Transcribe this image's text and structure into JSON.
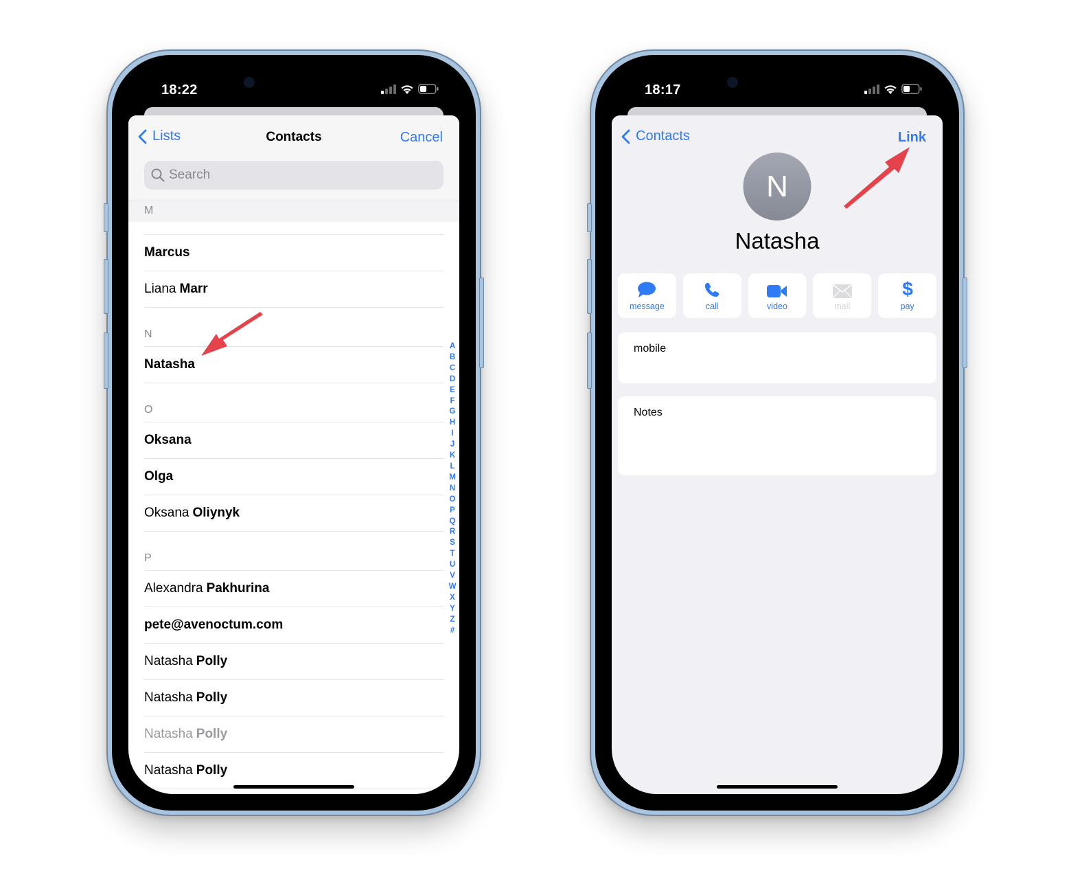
{
  "left_phone": {
    "status": {
      "time": "18:22"
    },
    "navbar": {
      "back_label": "Lists",
      "title": "Contacts",
      "right_label": "Cancel"
    },
    "search": {
      "placeholder": "Search"
    },
    "sections": [
      {
        "letter": "M",
        "rows": [
          {
            "first": "",
            "last": "Marcus",
            "dim": false
          },
          {
            "first": "Liana",
            "last": "Marr",
            "dim": false
          }
        ]
      },
      {
        "letter": "N",
        "rows": [
          {
            "first": "",
            "last": "Natasha",
            "dim": false
          }
        ]
      },
      {
        "letter": "O",
        "rows": [
          {
            "first": "",
            "last": "Oksana",
            "dim": false
          },
          {
            "first": "",
            "last": "Olga",
            "dim": false
          },
          {
            "first": "Oksana",
            "last": "Oliynyk",
            "dim": false
          }
        ]
      },
      {
        "letter": "P",
        "rows": [
          {
            "first": "Alexandra",
            "last": "Pakhurina",
            "dim": false
          },
          {
            "first": "",
            "last": "pete@avenoctum.com",
            "dim": false
          },
          {
            "first": "Natasha",
            "last": "Polly",
            "dim": false
          },
          {
            "first": "Natasha",
            "last": "Polly",
            "dim": false
          },
          {
            "first": "Natasha",
            "last": "Polly",
            "dim": true
          },
          {
            "first": "Natasha",
            "last": "Polly",
            "dim": false
          }
        ]
      }
    ],
    "index_letters": [
      "A",
      "B",
      "C",
      "D",
      "E",
      "F",
      "G",
      "H",
      "I",
      "J",
      "K",
      "L",
      "M",
      "N",
      "O",
      "P",
      "Q",
      "R",
      "S",
      "T",
      "U",
      "V",
      "W",
      "X",
      "Y",
      "Z",
      "#"
    ]
  },
  "right_phone": {
    "status": {
      "time": "18:17"
    },
    "navbar": {
      "back_label": "Contacts",
      "right_label": "Link"
    },
    "contact": {
      "initial": "N",
      "name": "Natasha"
    },
    "actions": [
      {
        "id": "message",
        "label": "message",
        "icon": "message-bubble-icon",
        "enabled": true
      },
      {
        "id": "call",
        "label": "call",
        "icon": "phone-icon",
        "enabled": true
      },
      {
        "id": "video",
        "label": "video",
        "icon": "video-camera-icon",
        "enabled": true
      },
      {
        "id": "mail",
        "label": "mail",
        "icon": "envelope-icon",
        "enabled": false
      },
      {
        "id": "pay",
        "label": "pay",
        "icon": "dollar-icon",
        "enabled": true
      }
    ],
    "fields": {
      "mobile_label": "mobile",
      "notes_label": "Notes"
    }
  },
  "colors": {
    "accent": "#2f7af6",
    "annotation_arrow": "#e5434b",
    "frame": "#a9c4df"
  }
}
